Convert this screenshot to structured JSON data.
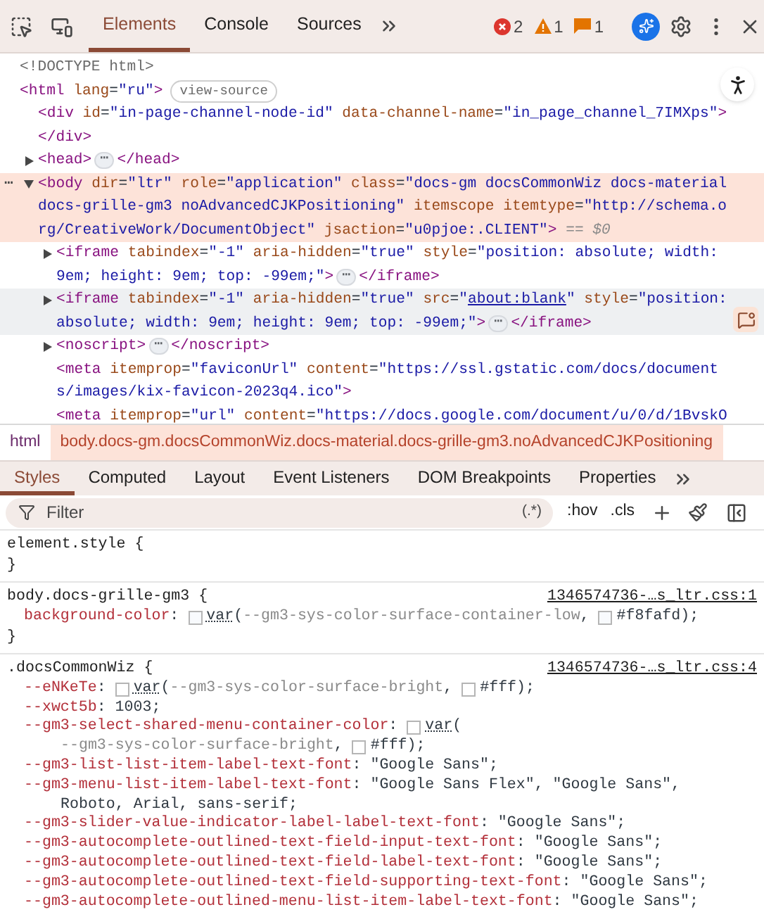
{
  "toolbar": {
    "tabs": [
      {
        "label": "Elements",
        "selected": true
      },
      {
        "label": "Console",
        "selected": false
      },
      {
        "label": "Sources",
        "selected": false
      }
    ],
    "issues": [
      {
        "kind": "error",
        "count": "2"
      },
      {
        "kind": "warning",
        "count": "1"
      },
      {
        "kind": "info",
        "count": "1"
      }
    ]
  },
  "dom_tree": {
    "nodes": [
      {
        "selected": false,
        "hovered": false,
        "lines": [
          [
            {
              "kind": "doctype",
              "text": "<!DOCTYPE html>"
            }
          ]
        ]
      },
      {
        "selected": false,
        "hovered": false,
        "lines": [
          [
            {
              "kind": "tag",
              "text": "<html"
            },
            {
              "kind": "attr",
              "text": " lang"
            },
            {
              "kind": "plain",
              "text": "="
            },
            {
              "kind": "value",
              "text": "\"ru\""
            },
            {
              "kind": "tag",
              "text": ">"
            },
            {
              "kind": "badge",
              "text": "view-source"
            }
          ]
        ],
        "children": [
          {
            "selected": false,
            "hovered": false,
            "lines": [
              [
                {
                  "kind": "tag",
                  "text": "<div"
                },
                {
                  "kind": "attr",
                  "text": " id"
                },
                {
                  "kind": "plain",
                  "text": "="
                },
                {
                  "kind": "value",
                  "text": "\"in-page-channel-node-id\""
                },
                {
                  "kind": "attr",
                  "text": " data-channel-name"
                },
                {
                  "kind": "plain",
                  "text": "="
                },
                {
                  "kind": "value",
                  "text": "\"in_page_channel_7IMXps\""
                },
                {
                  "kind": "tag",
                  "text": ">"
                }
              ]
            ],
            "closing": [
              {
                "kind": "tag",
                "text": "</div>"
              }
            ]
          },
          {
            "selected": false,
            "hovered": false,
            "expanded": false,
            "lines": [
              [
                {
                  "kind": "tag",
                  "text": "<head>"
                },
                {
                  "kind": "ellipsis",
                  "text": "⋯"
                },
                {
                  "kind": "tag",
                  "text": "</head>"
                }
              ]
            ]
          },
          {
            "selected": true,
            "hovered": false,
            "expanded": true,
            "gutter": "⋯",
            "lines": [
              [
                {
                  "kind": "tag",
                  "text": "<body"
                },
                {
                  "kind": "attr",
                  "text": " dir"
                },
                {
                  "kind": "plain",
                  "text": "="
                },
                {
                  "kind": "value",
                  "text": "\"ltr\""
                },
                {
                  "kind": "attr",
                  "text": " role"
                },
                {
                  "kind": "plain",
                  "text": "="
                },
                {
                  "kind": "value",
                  "text": "\"application\""
                },
                {
                  "kind": "attr",
                  "text": " class"
                },
                {
                  "kind": "plain",
                  "text": "="
                },
                {
                  "kind": "value",
                  "text": "\"docs-gm docsCommonWiz docs-material"
                }
              ],
              [
                {
                  "kind": "value",
                  "text": "docs-grille-gm3 noAdvancedCJKPositioning\""
                },
                {
                  "kind": "attr",
                  "text": " itemscope"
                },
                {
                  "kind": "attr",
                  "text": " itemtype"
                },
                {
                  "kind": "plain",
                  "text": "="
                },
                {
                  "kind": "value",
                  "text": "\"http://schema.o"
                }
              ],
              [
                {
                  "kind": "value",
                  "text": "rg/CreativeWork/DocumentObject\""
                },
                {
                  "kind": "attr",
                  "text": " jsaction"
                },
                {
                  "kind": "plain",
                  "text": "="
                },
                {
                  "kind": "value",
                  "text": "\"u0pjoe:.CLIENT\""
                },
                {
                  "kind": "tag",
                  "text": ">"
                },
                {
                  "kind": "dim",
                  "text": " == $0"
                }
              ]
            ],
            "children": [
              {
                "selected": false,
                "hovered": false,
                "expanded": false,
                "lines": [
                  [
                    {
                      "kind": "tag",
                      "text": "<iframe"
                    },
                    {
                      "kind": "attr",
                      "text": " tabindex"
                    },
                    {
                      "kind": "plain",
                      "text": "="
                    },
                    {
                      "kind": "value",
                      "text": "\"-1\""
                    },
                    {
                      "kind": "attr",
                      "text": " aria-hidden"
                    },
                    {
                      "kind": "plain",
                      "text": "="
                    },
                    {
                      "kind": "value",
                      "text": "\"true\""
                    },
                    {
                      "kind": "attr",
                      "text": " style"
                    },
                    {
                      "kind": "plain",
                      "text": "="
                    },
                    {
                      "kind": "value",
                      "text": "\"position: absolute; width:"
                    }
                  ],
                  [
                    {
                      "kind": "value",
                      "text": "9em; height: 9em; top: -99em;\""
                    },
                    {
                      "kind": "tag",
                      "text": ">"
                    },
                    {
                      "kind": "ellipsis",
                      "text": "⋯"
                    },
                    {
                      "kind": "tag",
                      "text": "</iframe>"
                    }
                  ]
                ]
              },
              {
                "selected": false,
                "hovered": true,
                "expanded": false,
                "lines": [
                  [
                    {
                      "kind": "tag",
                      "text": "<iframe"
                    },
                    {
                      "kind": "attr",
                      "text": " tabindex"
                    },
                    {
                      "kind": "plain",
                      "text": "="
                    },
                    {
                      "kind": "value",
                      "text": "\"-1\""
                    },
                    {
                      "kind": "attr",
                      "text": " aria-hidden"
                    },
                    {
                      "kind": "plain",
                      "text": "="
                    },
                    {
                      "kind": "value",
                      "text": "\"true\""
                    },
                    {
                      "kind": "attr",
                      "text": " src"
                    },
                    {
                      "kind": "plain",
                      "text": "="
                    },
                    {
                      "kind": "value",
                      "text": "\""
                    },
                    {
                      "kind": "link",
                      "text": "about:blank"
                    },
                    {
                      "kind": "value",
                      "text": "\""
                    },
                    {
                      "kind": "attr",
                      "text": " style"
                    },
                    {
                      "kind": "plain",
                      "text": "="
                    },
                    {
                      "kind": "value",
                      "text": "\"position:"
                    }
                  ],
                  [
                    {
                      "kind": "value",
                      "text": "absolute; width: 9em; height: 9em; top: -99em;\""
                    },
                    {
                      "kind": "tag",
                      "text": ">"
                    },
                    {
                      "kind": "ellipsis",
                      "text": "⋯"
                    },
                    {
                      "kind": "tag",
                      "text": "</iframe>"
                    }
                  ]
                ]
              },
              {
                "selected": false,
                "hovered": false,
                "expanded": false,
                "lines": [
                  [
                    {
                      "kind": "tag",
                      "text": "<noscript>"
                    },
                    {
                      "kind": "ellipsis",
                      "text": "⋯"
                    },
                    {
                      "kind": "tag",
                      "text": "</noscript>"
                    }
                  ]
                ]
              },
              {
                "selected": false,
                "hovered": false,
                "lines": [
                  [
                    {
                      "kind": "tag",
                      "text": "<meta"
                    },
                    {
                      "kind": "attr",
                      "text": " itemprop"
                    },
                    {
                      "kind": "plain",
                      "text": "="
                    },
                    {
                      "kind": "value",
                      "text": "\"faviconUrl\""
                    },
                    {
                      "kind": "attr",
                      "text": " content"
                    },
                    {
                      "kind": "plain",
                      "text": "="
                    },
                    {
                      "kind": "value",
                      "text": "\"https://ssl.gstatic.com/docs/document"
                    }
                  ],
                  [
                    {
                      "kind": "value",
                      "text": "s/images/kix-favicon-2023q4.ico\""
                    },
                    {
                      "kind": "tag",
                      "text": ">"
                    }
                  ]
                ]
              },
              {
                "selected": false,
                "hovered": false,
                "lines": [
                  [
                    {
                      "kind": "tag",
                      "text": "<meta"
                    },
                    {
                      "kind": "attr",
                      "text": " itemprop"
                    },
                    {
                      "kind": "plain",
                      "text": "="
                    },
                    {
                      "kind": "value",
                      "text": "\"url\""
                    },
                    {
                      "kind": "attr",
                      "text": " content"
                    },
                    {
                      "kind": "plain",
                      "text": "="
                    },
                    {
                      "kind": "value",
                      "text": "\"https://docs.google.com/document/u/0/d/1BvskO"
                    }
                  ]
                ]
              }
            ]
          }
        ]
      }
    ]
  },
  "breadcrumbs": [
    {
      "label": "html",
      "selected": false
    },
    {
      "label": "body.docs-gm.docsCommonWiz.docs-material.docs-grille-gm3.noAdvancedCJKPositioning",
      "selected": true
    }
  ],
  "sidebar_tabs": [
    {
      "label": "Styles",
      "selected": true
    },
    {
      "label": "Computed",
      "selected": false
    },
    {
      "label": "Layout",
      "selected": false
    },
    {
      "label": "Event Listeners",
      "selected": false
    },
    {
      "label": "DOM Breakpoints",
      "selected": false
    },
    {
      "label": "Properties",
      "selected": false
    }
  ],
  "filter": {
    "placeholder": "Filter",
    "tools": [
      "(.*)",
      ":hov",
      ".cls"
    ]
  },
  "rules": [
    {
      "selector": "element.style {",
      "close": "}"
    },
    {
      "selector": "body.docs-grille-gm3 {",
      "source": "1346574736-…s_ltr.css:1",
      "close": "}",
      "decls": [
        {
          "name": "background-color",
          "lines": [
            [
              {
                "kind": "plain",
                "text": ": "
              },
              {
                "kind": "swatch",
                "color": "#f8fafd"
              },
              {
                "kind": "fn",
                "text": "var"
              },
              {
                "kind": "plain",
                "text": "("
              },
              {
                "kind": "varname",
                "text": "--gm3-sys-color-surface-container-low"
              },
              {
                "kind": "plain",
                "text": ", "
              },
              {
                "kind": "swatch",
                "color": "#f8fafd"
              },
              {
                "kind": "plain",
                "text": "#f8fafd);"
              }
            ]
          ]
        }
      ]
    },
    {
      "selector": ".docsCommonWiz {",
      "source": "1346574736-…s_ltr.css:4",
      "decls": [
        {
          "name": "--eNKeTe",
          "lines": [
            [
              {
                "kind": "plain",
                "text": ": "
              },
              {
                "kind": "swatch",
                "color": "#ffffff"
              },
              {
                "kind": "fn",
                "text": "var"
              },
              {
                "kind": "plain",
                "text": "("
              },
              {
                "kind": "varname",
                "text": "--gm3-sys-color-surface-bright"
              },
              {
                "kind": "plain",
                "text": ", "
              },
              {
                "kind": "swatch",
                "color": "#ffffff"
              },
              {
                "kind": "plain",
                "text": "#fff);"
              }
            ]
          ]
        },
        {
          "name": "--xwct5b",
          "lines": [
            [
              {
                "kind": "plain",
                "text": ": 1003;"
              }
            ]
          ]
        },
        {
          "name": "--gm3-select-shared-menu-container-color",
          "lines": [
            [
              {
                "kind": "plain",
                "text": ": "
              },
              {
                "kind": "swatch",
                "color": "#ffffff"
              },
              {
                "kind": "fn",
                "text": "var"
              },
              {
                "kind": "plain",
                "text": "("
              }
            ],
            [
              {
                "kind": "varname",
                "text": "--gm3-sys-color-surface-bright"
              },
              {
                "kind": "plain",
                "text": ", "
              },
              {
                "kind": "swatch",
                "color": "#ffffff"
              },
              {
                "kind": "plain",
                "text": "#fff);"
              }
            ]
          ]
        },
        {
          "name": "--gm3-list-list-item-label-text-font",
          "lines": [
            [
              {
                "kind": "plain",
                "text": ": \"Google Sans\";"
              }
            ]
          ]
        },
        {
          "name": "--gm3-menu-list-item-label-text-font",
          "lines": [
            [
              {
                "kind": "plain",
                "text": ": \"Google Sans Flex\", \"Google Sans\","
              }
            ],
            [
              {
                "kind": "plain",
                "text": "Roboto, Arial, sans-serif;"
              }
            ]
          ]
        },
        {
          "name": "--gm3-slider-value-indicator-label-label-text-font",
          "lines": [
            [
              {
                "kind": "plain",
                "text": ": \"Google Sans\";"
              }
            ]
          ]
        },
        {
          "name": "--gm3-autocomplete-outlined-text-field-input-text-font",
          "lines": [
            [
              {
                "kind": "plain",
                "text": ": \"Google Sans\";"
              }
            ]
          ]
        },
        {
          "name": "--gm3-autocomplete-outlined-text-field-label-text-font",
          "lines": [
            [
              {
                "kind": "plain",
                "text": ": \"Google Sans\";"
              }
            ]
          ]
        },
        {
          "name": "--gm3-autocomplete-outlined-text-field-supporting-text-font",
          "lines": [
            [
              {
                "kind": "plain",
                "text": ": \"Google Sans\";"
              }
            ]
          ]
        },
        {
          "name": "--gm3-autocomplete-outlined-menu-list-item-label-text-font",
          "lines": [
            [
              {
                "kind": "plain",
                "text": ": \"Google Sans\";"
              }
            ]
          ]
        }
      ]
    }
  ]
}
